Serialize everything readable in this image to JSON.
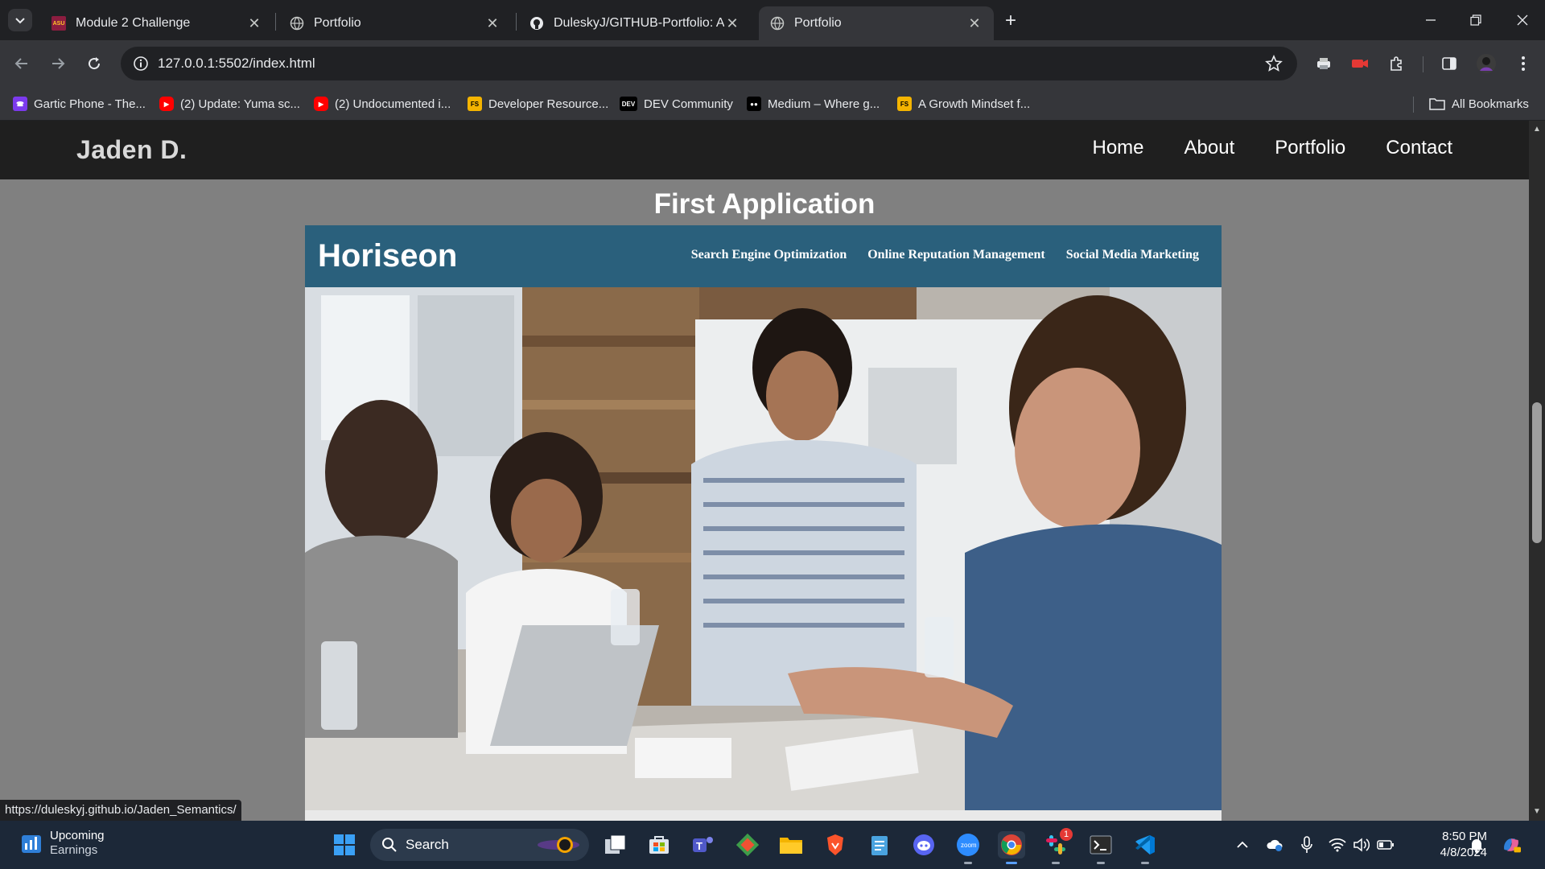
{
  "browser": {
    "tabs": [
      {
        "title": "Module 2 Challenge",
        "favicon": "asu-icon",
        "active": false
      },
      {
        "title": "Portfolio",
        "favicon": "globe-icon",
        "active": false
      },
      {
        "title": "DuleskyJ/GITHUB-Portfolio: A w",
        "favicon": "github-icon",
        "active": false
      },
      {
        "title": "Portfolio",
        "favicon": "globe-icon",
        "active": true
      }
    ],
    "url": "127.0.0.1:5502/index.html",
    "bookmarks": [
      {
        "label": "Gartic Phone - The...",
        "favicon": "phone-icon",
        "color": "#7c3aed"
      },
      {
        "label": "(2) Update: Yuma sc...",
        "favicon": "youtube-icon",
        "color": "#ff0000"
      },
      {
        "label": "(2) Undocumented i...",
        "favicon": "youtube-icon",
        "color": "#ff0000"
      },
      {
        "label": "Developer Resource...",
        "favicon": "fs-icon",
        "color": "#f4b400"
      },
      {
        "label": "DEV Community",
        "favicon": "dev-icon",
        "color": "#000000"
      },
      {
        "label": "Medium – Where g...",
        "favicon": "medium-icon",
        "color": "#000000"
      },
      {
        "label": "A Growth Mindset f...",
        "favicon": "fs-icon",
        "color": "#f4b400"
      }
    ],
    "all_bookmarks_label": "All Bookmarks",
    "status_url": "https://duleskyj.github.io/Jaden_Semantics/"
  },
  "site": {
    "logo": "Jaden D.",
    "nav": [
      "Home",
      "About",
      "Portfolio",
      "Contact"
    ],
    "section_title": "First Application",
    "project": {
      "logo": "Horiseon",
      "nav": [
        "Search Engine Optimization",
        "Online Reputation Management",
        "Social Media Marketing"
      ],
      "header_color": "#2a607c"
    }
  },
  "taskbar": {
    "widget_title": "Upcoming",
    "widget_subtitle": "Earnings",
    "search_label": "Search",
    "time": "8:50 PM",
    "date": "4/8/2024",
    "slack_badge": "1"
  }
}
